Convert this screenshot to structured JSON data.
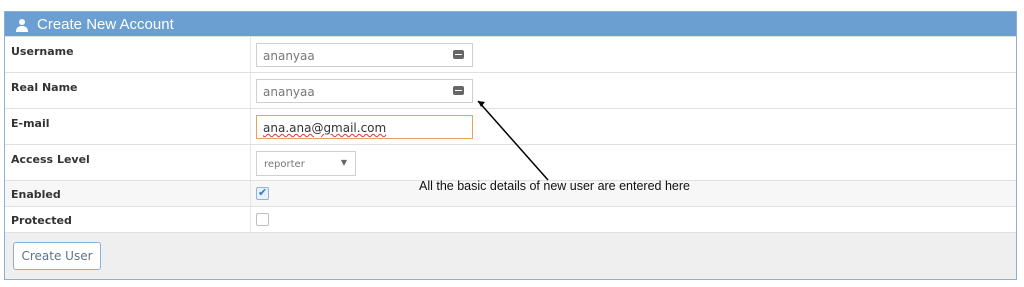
{
  "panel": {
    "title": "Create New Account",
    "header_icon": "user-icon",
    "header_color": "#6b9fd1"
  },
  "form": {
    "username": {
      "label": "Username",
      "value": "ananyaa",
      "icon": "keyboard-icon"
    },
    "real_name": {
      "label": "Real Name",
      "value": "ananyaa",
      "icon": "keyboard-icon"
    },
    "email": {
      "label": "E-mail",
      "value": "ana.ana@gmail.com",
      "focus_color": "#e8a35c"
    },
    "access_level": {
      "label": "Access Level",
      "value": "reporter",
      "icon": "chevron-down-icon"
    },
    "enabled": {
      "label": "Enabled",
      "checked": true
    },
    "protected": {
      "label": "Protected",
      "checked": false
    }
  },
  "actions": {
    "create_label": "Create User"
  },
  "annotation": {
    "text": "All the basic details of new user are entered here"
  }
}
